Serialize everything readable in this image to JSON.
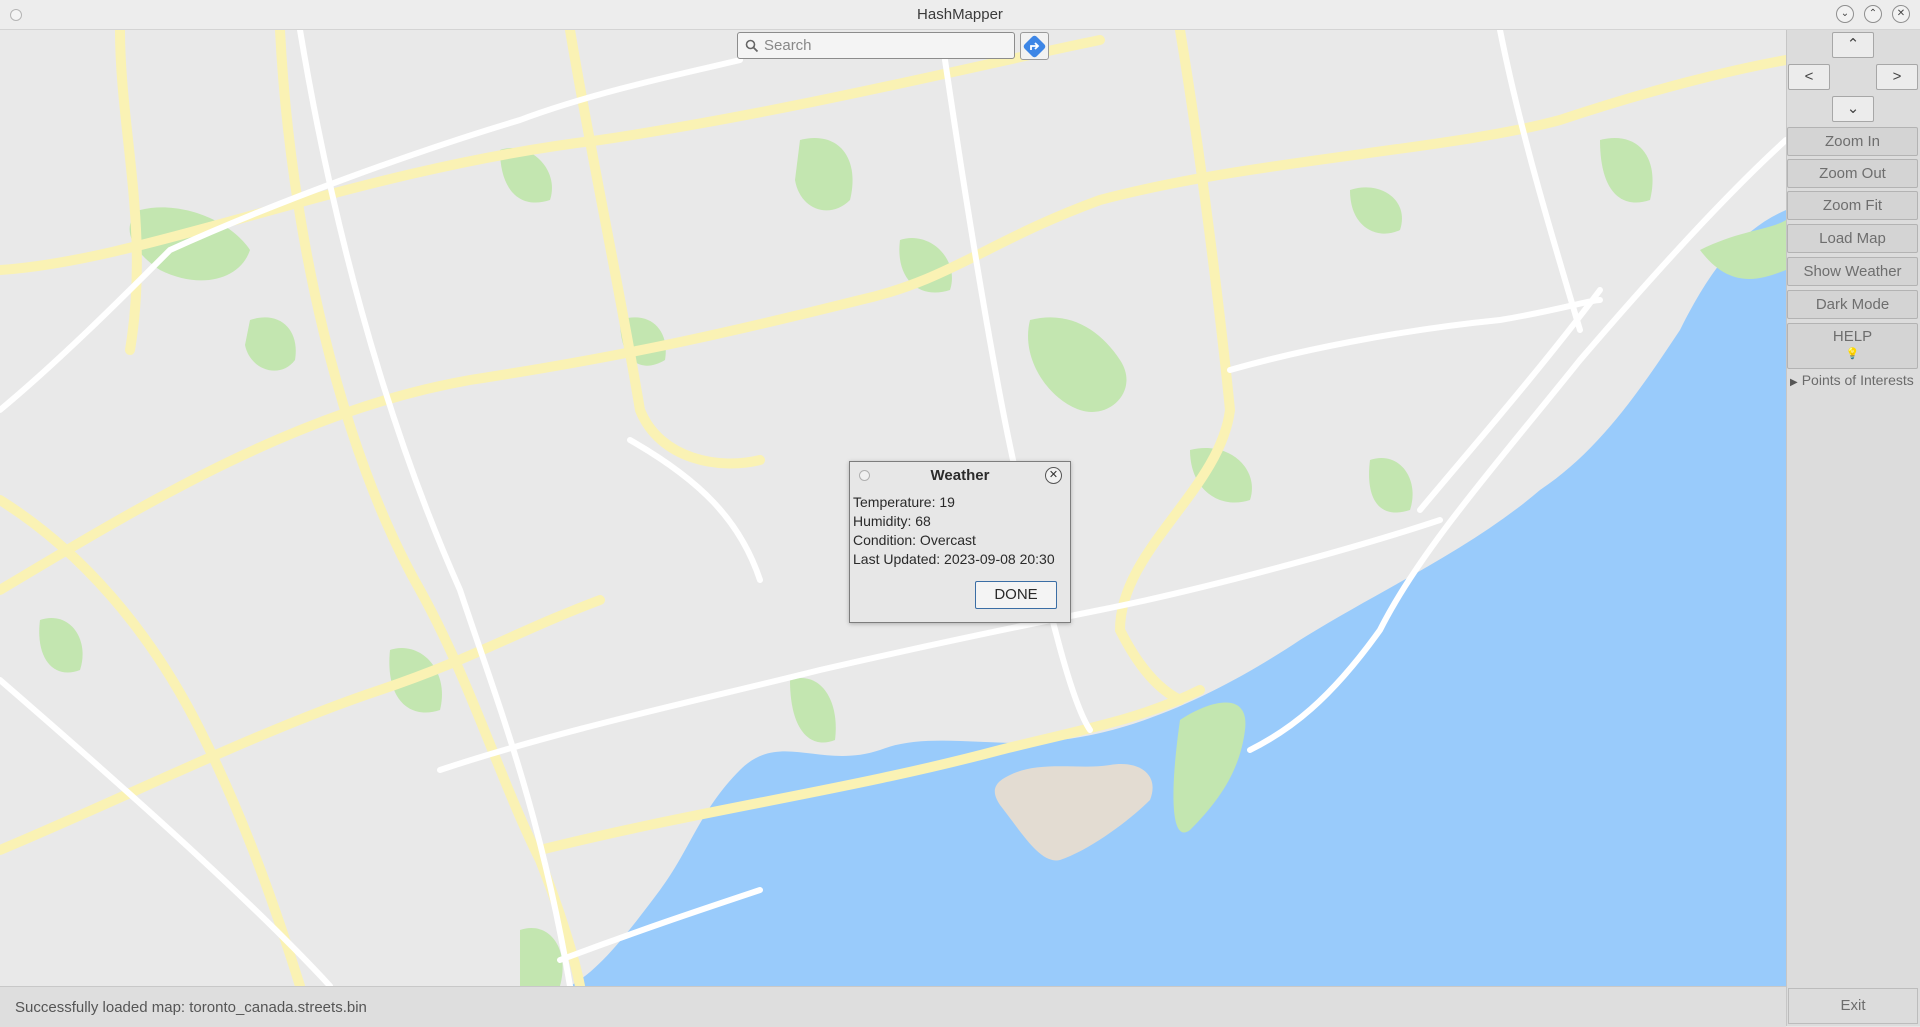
{
  "window": {
    "title": "HashMapper"
  },
  "search": {
    "placeholder": "Search"
  },
  "panel": {
    "nav": {
      "up": "⌃",
      "left": "<",
      "right": ">",
      "down": "⌄"
    },
    "buttons": {
      "zoom_in": "Zoom In",
      "zoom_out": "Zoom Out",
      "zoom_fit": "Zoom Fit",
      "load_map": "Load Map",
      "show_weather": "Show Weather",
      "dark_mode": "Dark Mode",
      "help": "HELP"
    },
    "poi_label": "Points of Interests",
    "exit": "Exit"
  },
  "status": {
    "message": "Successfully loaded map: toronto_canada.streets.bin"
  },
  "weather_dialog": {
    "title": "Weather",
    "temperature": "Temperature: 19",
    "humidity": "Humidity: 68",
    "condition": "Condition: Overcast",
    "last_updated": "Last Updated: 2023-09-08 20:30",
    "done": "DONE"
  },
  "colors": {
    "water": "#99cbfb",
    "park": "#c3e6b0",
    "highway": "#faf2b4",
    "street": "#ffffff",
    "land": "#e9e9e9",
    "accent": "#3d86e6"
  },
  "icons": {
    "search": "search-icon",
    "route": "route-icon",
    "help": "lightbulb-icon",
    "close": "close-icon"
  }
}
